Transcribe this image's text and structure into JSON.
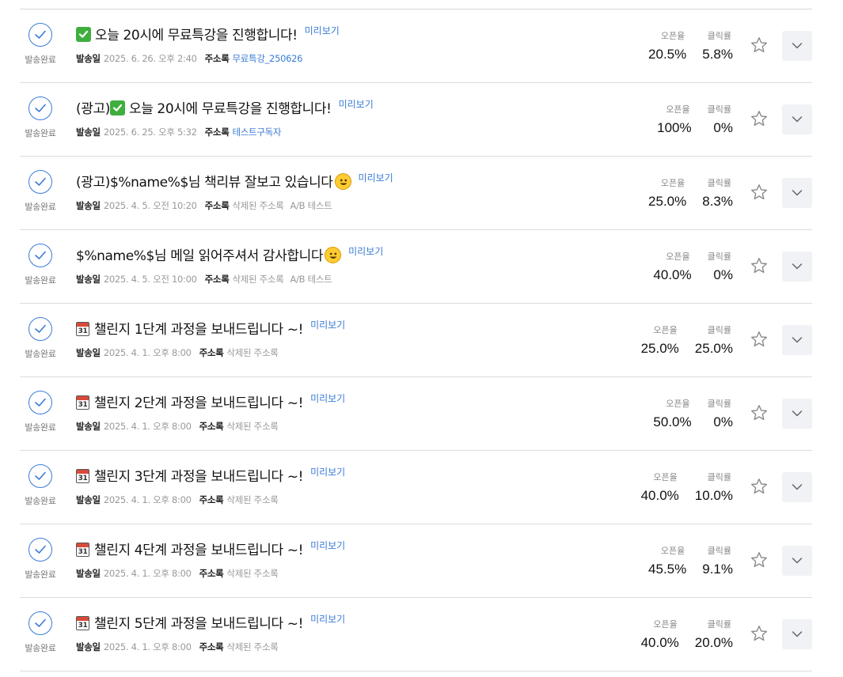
{
  "labels": {
    "status": "발송완료",
    "preview": "미리보기",
    "send_date": "발송일",
    "address_book": "주소록",
    "open_rate": "오픈율",
    "click_rate": "클릭률"
  },
  "colors": {
    "accent": "#3a7bd5",
    "muted": "#999999",
    "button_bg": "#f1f2f5"
  },
  "rows": [
    {
      "icon": "check-mark-emoji",
      "title": "오늘 20시에 무료특강을 진행합니다!",
      "title_suffix": "",
      "date": "2025. 6. 26. 오후 2:40",
      "list": "무료특강_250626",
      "list_deleted": false,
      "extra": "",
      "open": "20.5%",
      "click": "5.8%"
    },
    {
      "icon": "check-mark-emoji",
      "title_prefix": "(광고)",
      "title": "오늘 20시에 무료특강을 진행합니다!",
      "date": "2025. 6. 25. 오후 5:32",
      "list": "테스트구독자",
      "list_deleted": false,
      "extra": "",
      "open": "100%",
      "click": "0%"
    },
    {
      "icon": "smile-emoji",
      "title": "(광고)$%name%$님 책리뷰 잘보고 있습니다",
      "date": "2025. 4. 5. 오전 10:20",
      "list": "삭제된 주소록",
      "list_deleted": true,
      "extra": "A/B 테스트",
      "open": "25.0%",
      "click": "8.3%"
    },
    {
      "icon": "smile-emoji",
      "title": "$%name%$님 메일 읽어주셔서 감사합니다",
      "date": "2025. 4. 5. 오전 10:00",
      "list": "삭제된 주소록",
      "list_deleted": true,
      "extra": "A/B 테스트",
      "open": "40.0%",
      "click": "0%"
    },
    {
      "icon": "calendar-emoji",
      "calendar_number": "31",
      "title": "챌린지 1단계 과정을 보내드립니다 ~!",
      "date": "2025. 4. 1. 오후 8:00",
      "list": "삭제된 주소록",
      "list_deleted": true,
      "extra": "",
      "open": "25.0%",
      "click": "25.0%"
    },
    {
      "icon": "calendar-emoji",
      "calendar_number": "31",
      "title": "챌린지 2단계 과정을 보내드립니다 ~!",
      "date": "2025. 4. 1. 오후 8:00",
      "list": "삭제된 주소록",
      "list_deleted": true,
      "extra": "",
      "open": "50.0%",
      "click": "0%"
    },
    {
      "icon": "calendar-emoji",
      "calendar_number": "31",
      "title": "챌린지 3단계 과정을 보내드립니다 ~!",
      "date": "2025. 4. 1. 오후 8:00",
      "list": "삭제된 주소록",
      "list_deleted": true,
      "extra": "",
      "open": "40.0%",
      "click": "10.0%"
    },
    {
      "icon": "calendar-emoji",
      "calendar_number": "31",
      "title": "챌린지 4단계 과정을 보내드립니다 ~!",
      "date": "2025. 4. 1. 오후 8:00",
      "list": "삭제된 주소록",
      "list_deleted": true,
      "extra": "",
      "open": "45.5%",
      "click": "9.1%"
    },
    {
      "icon": "calendar-emoji",
      "calendar_number": "31",
      "title": "챌린지 5단계 과정을 보내드립니다 ~!",
      "date": "2025. 4. 1. 오후 8:00",
      "list": "삭제된 주소록",
      "list_deleted": true,
      "extra": "",
      "open": "40.0%",
      "click": "20.0%"
    }
  ]
}
